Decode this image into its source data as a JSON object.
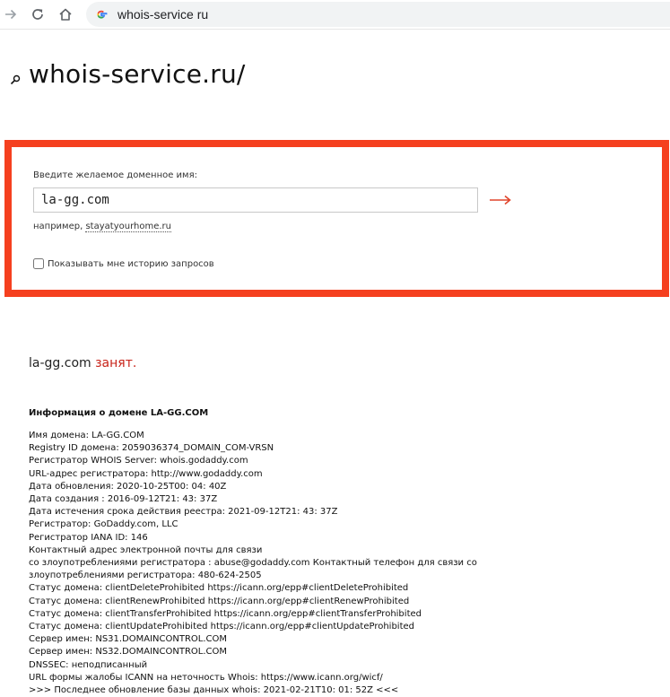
{
  "browser": {
    "address": "whois-service ru"
  },
  "header": {
    "title": "whois-service.ru/"
  },
  "search": {
    "label": "Введите желаемое доменное имя:",
    "value": "la-gg.com",
    "example_prefix": "например,",
    "example_link": "stayatyourhome.ru",
    "history_label": "Показывать мне историю запросов",
    "history_checked": false,
    "border_color": "#f5401f",
    "arrow_color": "#e0452c"
  },
  "result": {
    "domain": "la-gg.com",
    "status": "занят.",
    "status_color": "#c8241a"
  },
  "info": {
    "heading": "Информация о домене LA-GG.COM",
    "lines": [
      "Имя домена: LA-GG.COM",
      "Registry ID домена: 2059036374_DOMAIN_COM-VRSN",
      "Регистратор WHOIS Server: whois.godaddy.com",
      "URL-адрес регистратора: http://www.godaddy.com",
      "Дата обновления: 2020-10-25T00: 04: 40Z",
      "Дата создания : 2016-09-12T21: 43: 37Z",
      "Дата истечения срока действия реестра: 2021-09-12T21: 43: 37Z",
      "Регистратор: GoDaddy.com, LLC",
      "Регистратор IANA ID: 146",
      "Контактный адрес электронной почты для связи",
      "со злоупотреблениями регистратора : abuse@godaddy.com Контактный телефон для связи со",
      "злоупотреблениями регистратора: 480-624-2505",
      "Статус домена: clientDeleteProhibited https://icann.org/epp#clientDeleteProhibited",
      "Статус домена: clientRenewProhibited https://icann.org/epp#clientRenewProhibited",
      "Статус домена: clientTransferProhibited https://icann.org/epp#clientTransferProhibited",
      "Статус домена: clientUpdateProhibited https://icann.org/epp#clientUpdateProhibited",
      "Сервер имен: NS31.DOMAINCONTROL.COM",
      "Сервер имен: NS32.DOMAINCONTROL.COM",
      "DNSSEC: неподписанный",
      "URL формы жалобы ICANN на неточность Whois: https://www.icann.org/wicf/",
      ">>> Последнее обновление базы данных whois: 2021-02-21T10: 01: 52Z <<<"
    ]
  }
}
